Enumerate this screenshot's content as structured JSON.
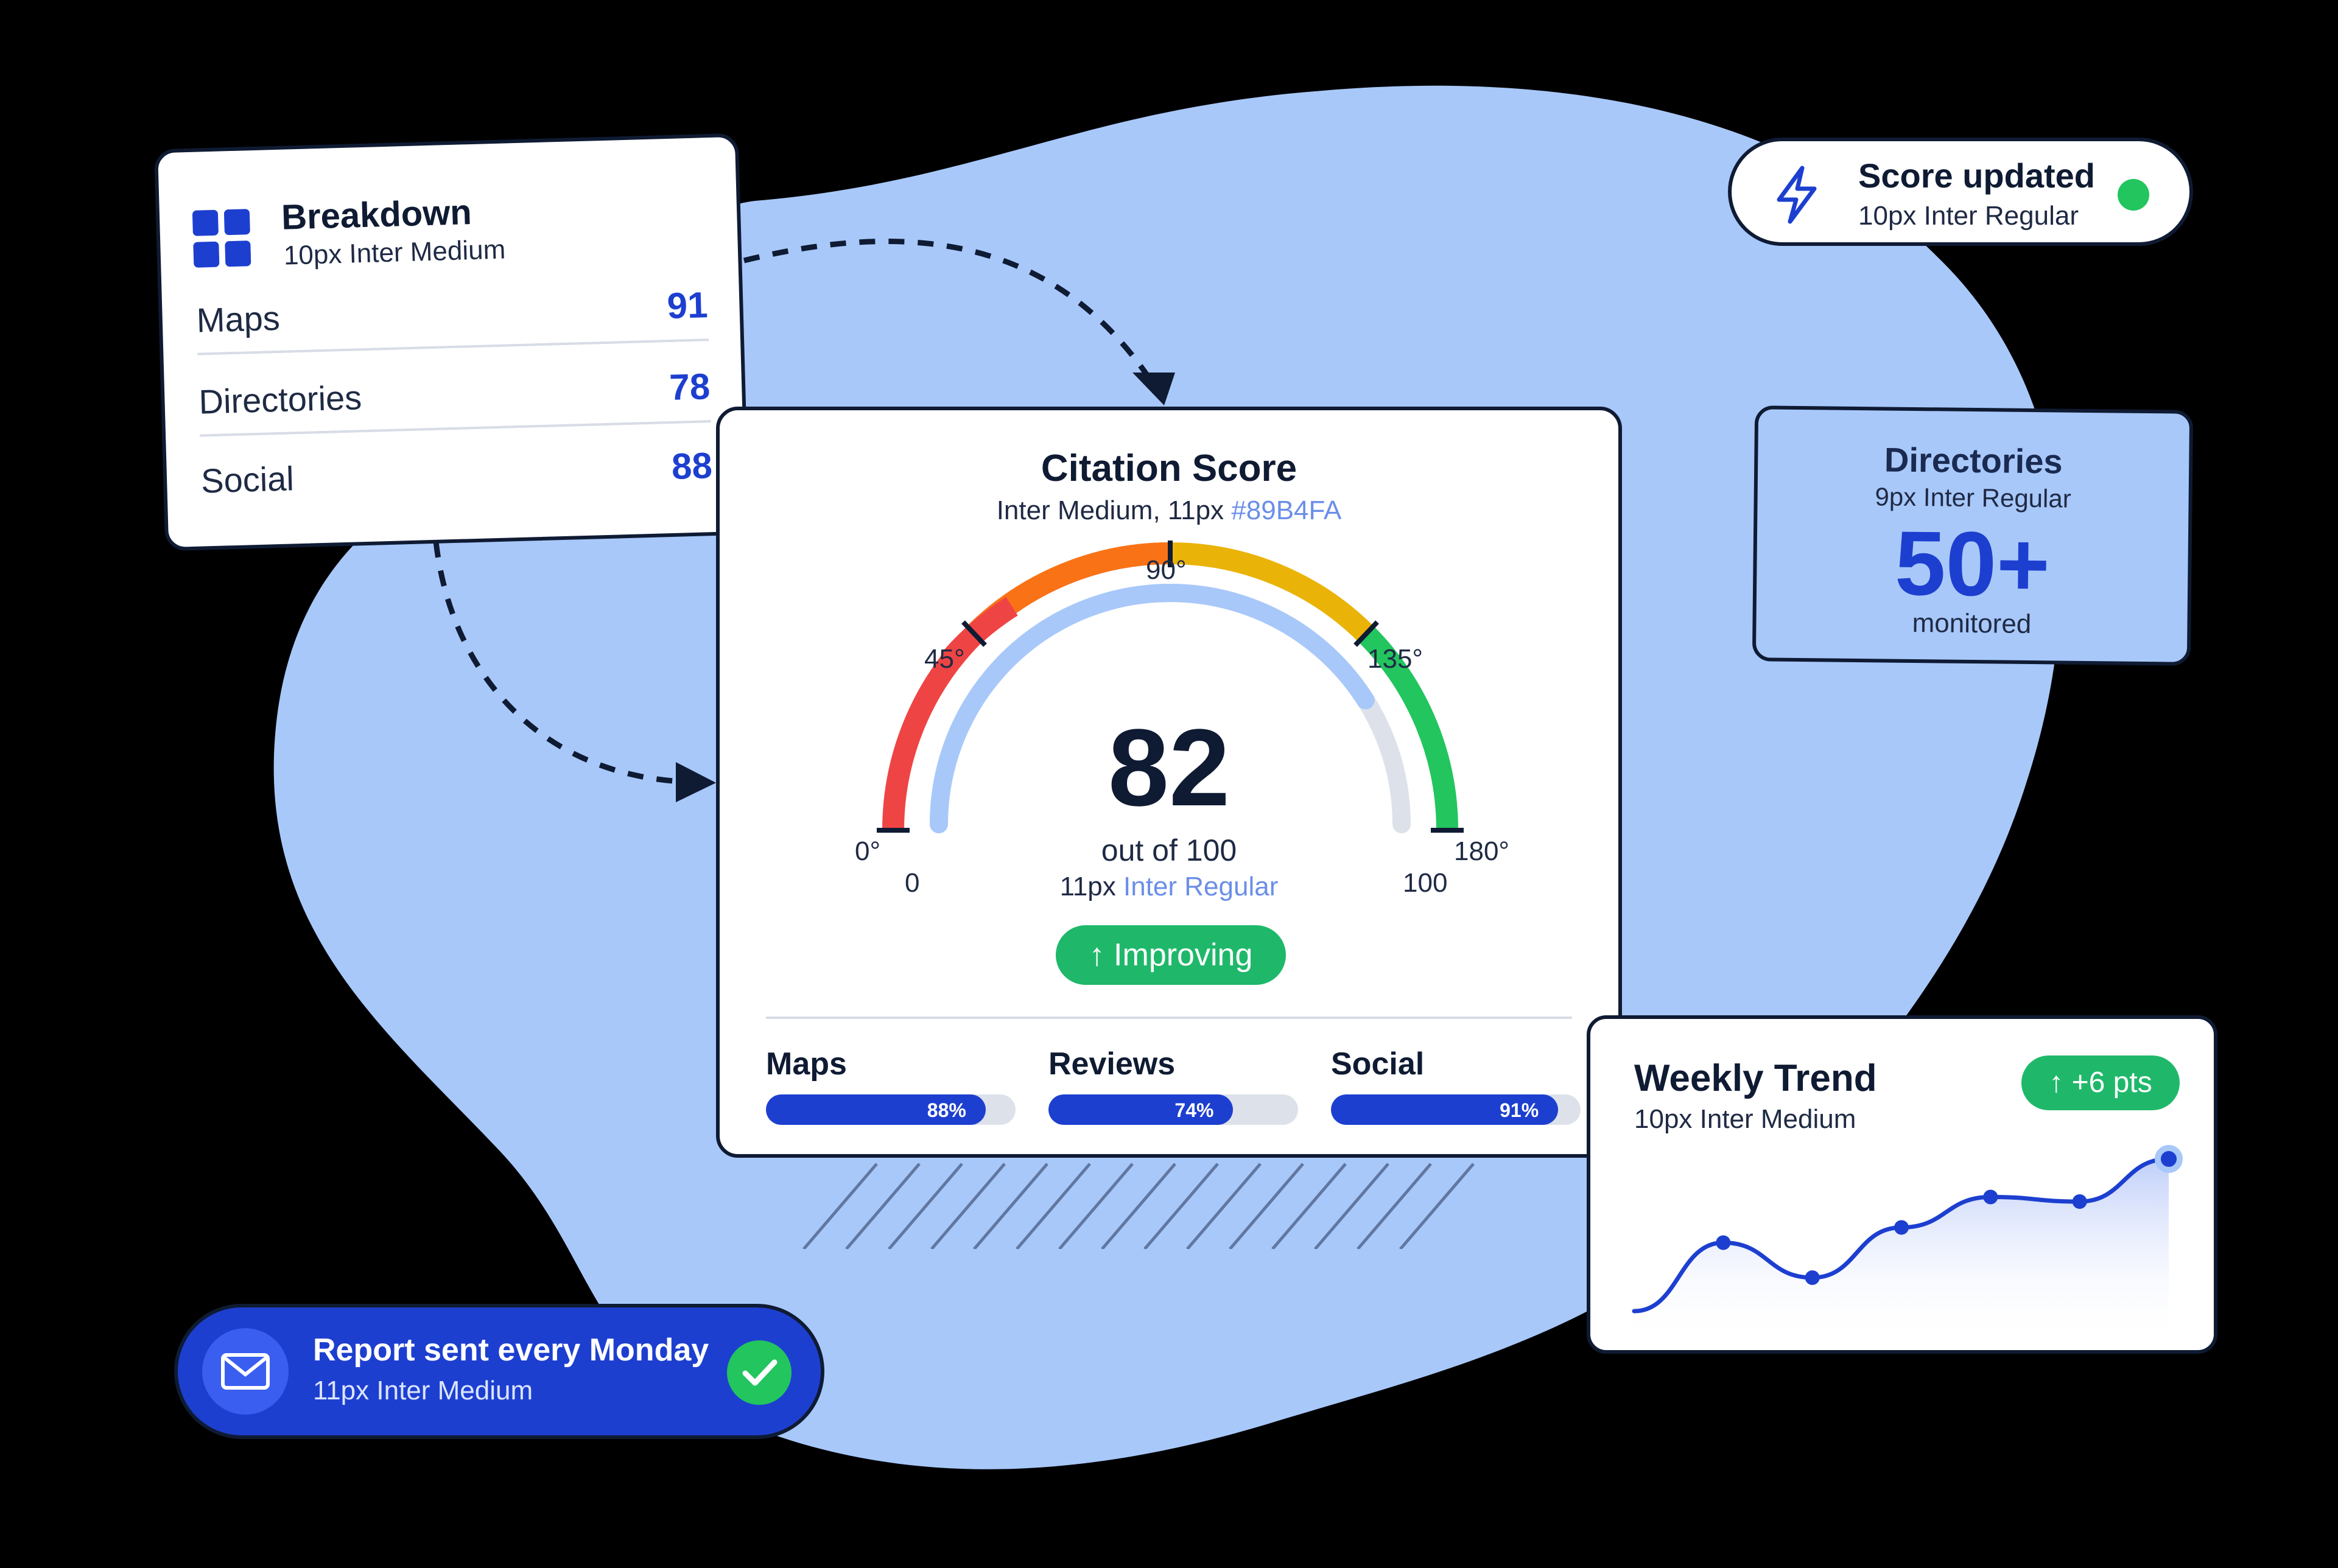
{
  "colors": {
    "background": "#000000",
    "blob": "#a8c8fa",
    "accent": "#1d3fd0",
    "success": "#1fb86a",
    "dark": "#0f1b33",
    "highlight_text": "#89B4FA"
  },
  "breakdown": {
    "icon": "grid-icon",
    "title": "Breakdown",
    "subtitle": "10px Inter Medium",
    "rows": [
      {
        "label": "Maps",
        "value": "91"
      },
      {
        "label": "Directories",
        "value": "78"
      },
      {
        "label": "Social",
        "value": "88"
      }
    ]
  },
  "score_update": {
    "icon": "lightning-icon",
    "title": "Score updated",
    "subtitle": "10px Inter Regular",
    "status": "online-dot"
  },
  "directories": {
    "title": "Directories",
    "subtitle": "9px Inter Regular",
    "value": "50+",
    "caption": "monitored"
  },
  "citation": {
    "title": "Citation Score",
    "subtitle_prefix": "Inter Medium, 11px ",
    "subtitle_hex": "#89B4FA",
    "gauge": {
      "min_label": "0",
      "max_label": "100",
      "degree_labels": [
        "0°",
        "45°",
        "90°",
        "135°",
        "180°"
      ],
      "score": 82,
      "max": 100
    },
    "score_text": "82",
    "out_of": "out of 100",
    "font_prefix": "11px ",
    "font_name": "Inter Regular",
    "status": "↑ Improving",
    "bars": [
      {
        "label": "Maps",
        "value": 88,
        "text": "88%"
      },
      {
        "label": "Reviews",
        "value": 74,
        "text": "74%"
      },
      {
        "label": "Social",
        "value": 91,
        "text": "91%"
      }
    ]
  },
  "weekly_trend": {
    "title": "Weekly Trend",
    "subtitle": "10px Inter Medium",
    "badge": "↑ +6 pts",
    "points": [
      0,
      45,
      22,
      55,
      75,
      72,
      100
    ]
  },
  "report": {
    "icon": "mail-icon",
    "title": "Report sent every Monday",
    "subtitle": "11px Inter Medium",
    "status_icon": "check-icon"
  }
}
